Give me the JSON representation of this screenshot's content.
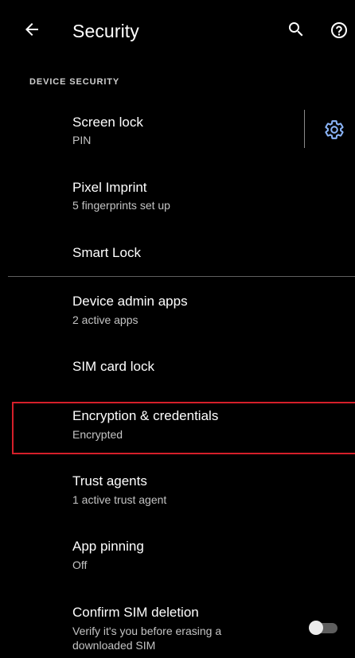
{
  "app_bar": {
    "title": "Security",
    "back_icon": "arrow-back-icon",
    "search_icon": "search-icon",
    "help_icon": "help-icon"
  },
  "section": {
    "header": "DEVICE SECURITY"
  },
  "items": [
    {
      "title": "Screen lock",
      "subtitle": "PIN",
      "settings_icon": "gear-icon"
    },
    {
      "title": "Pixel Imprint",
      "subtitle": "5 fingerprints set up"
    },
    {
      "title": "Smart Lock"
    },
    {
      "title": "Device admin apps",
      "subtitle": "2 active apps"
    },
    {
      "title": "SIM card lock"
    },
    {
      "title": "Encryption & credentials",
      "subtitle": "Encrypted",
      "highlighted": true
    },
    {
      "title": "Trust agents",
      "subtitle": "1 active trust agent"
    },
    {
      "title": "App pinning",
      "subtitle": "Off"
    },
    {
      "title": "Confirm SIM deletion",
      "subtitle_line1": "Verify it's you before erasing a",
      "subtitle_line2": "downloaded SIM",
      "toggle_on": false
    }
  ],
  "colors": {
    "background": "#000000",
    "accent": "#8ab4f8",
    "highlight": "#d51f2a"
  }
}
